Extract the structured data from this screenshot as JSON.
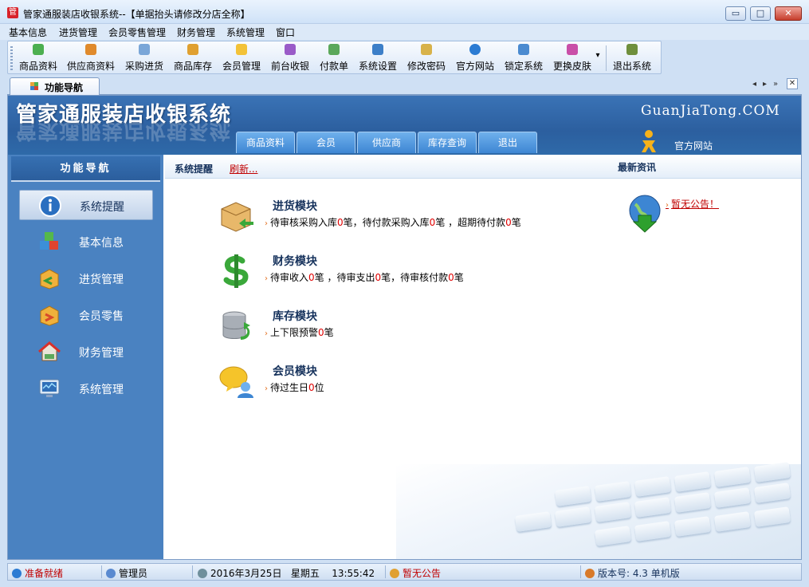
{
  "window": {
    "title": "管家通服装店收银系统--【单据抬头请修改分店全称】",
    "app_icon": "管",
    "minimize_glyph": "▭",
    "maximize_glyph": "□",
    "close_glyph": "✕"
  },
  "menu": [
    "基本信息",
    "进货管理",
    "会员零售管理",
    "财务管理",
    "系统管理",
    "窗口"
  ],
  "toolbar": [
    {
      "label": "商品资料",
      "icon": "goods-icon",
      "color": "#4caf50"
    },
    {
      "label": "供应商资料",
      "icon": "supplier-icon",
      "color": "#e08a2c"
    },
    {
      "label": "采购进货",
      "icon": "purchase-icon",
      "color": "#7aa6d8"
    },
    {
      "label": "商品库存",
      "icon": "inventory-icon",
      "color": "#e0a030"
    },
    {
      "label": "会员管理",
      "icon": "member-icon",
      "color": "#f3c238"
    },
    {
      "label": "前台收银",
      "icon": "cashier-icon",
      "color": "#9a5bc8"
    },
    {
      "label": "付款单",
      "icon": "payment-icon",
      "color": "#5ba85b"
    },
    {
      "label": "系统设置",
      "icon": "settings-icon",
      "color": "#3d7fc8"
    },
    {
      "label": "修改密码",
      "icon": "key-icon",
      "color": "#d8b24a"
    },
    {
      "label": "官方网站",
      "icon": "ie-icon",
      "color": "#2b7bd3"
    },
    {
      "label": "锁定系统",
      "icon": "lock-icon",
      "color": "#4a8ad0"
    },
    {
      "label": "更换皮肤",
      "icon": "skin-icon",
      "color": "#c94fa8"
    },
    {
      "label": "退出系统",
      "icon": "exit-icon",
      "color": "#6f8f3c"
    }
  ],
  "toolbar_dropdown_glyph": "▾",
  "tabs": {
    "active": "功能导航",
    "prev_glyph": "◂",
    "next_glyph": "▸",
    "overflow_glyph": "»",
    "close_glyph": "✕"
  },
  "banner": {
    "title": "管家通服装店收银系统",
    "site": "GuanJiaTong.COM",
    "nav": [
      "商品资料",
      "会员",
      "供应商",
      "库存查询",
      "退出"
    ],
    "official_link": "官方网站"
  },
  "sidebar": {
    "title": "功能导航",
    "items": [
      {
        "label": "系统提醒",
        "icon": "info-icon",
        "active": true
      },
      {
        "label": "基本信息",
        "icon": "cubes-icon",
        "active": false
      },
      {
        "label": "进货管理",
        "icon": "box-in-icon",
        "active": false
      },
      {
        "label": "会员零售",
        "icon": "box-out-icon",
        "active": false
      },
      {
        "label": "财务管理",
        "icon": "house-money-icon",
        "active": false
      },
      {
        "label": "系统管理",
        "icon": "monitor-icon",
        "active": false
      }
    ]
  },
  "content": {
    "header": {
      "title": "系统提醒",
      "refresh": "刷新...",
      "news": "最新资讯"
    },
    "bullet": "›",
    "modules": [
      {
        "title": "进货模块",
        "icon": "box-arrow-icon",
        "line": [
          {
            "t": "待审核采购入库"
          },
          {
            "t": "0",
            "red": true
          },
          {
            "t": "笔，待付款采购入库"
          },
          {
            "t": "0",
            "red": true
          },
          {
            "t": "笔 ，超期待付款"
          },
          {
            "t": "0",
            "red": true
          },
          {
            "t": "笔"
          }
        ]
      },
      {
        "title": "财务模块",
        "icon": "dollar-icon",
        "line": [
          {
            "t": "待审收入"
          },
          {
            "t": "0",
            "red": true
          },
          {
            "t": "笔 ，待审支出"
          },
          {
            "t": "0",
            "red": true
          },
          {
            "t": "笔，待审核付款"
          },
          {
            "t": "0",
            "red": true
          },
          {
            "t": "笔"
          }
        ]
      },
      {
        "title": "库存模块",
        "icon": "database-icon",
        "line": [
          {
            "t": "上下限预警"
          },
          {
            "t": "0",
            "red": true
          },
          {
            "t": "笔"
          }
        ]
      },
      {
        "title": "会员模块",
        "icon": "chat-member-icon",
        "line": [
          {
            "t": "待过生日"
          },
          {
            "t": "0",
            "red": true
          },
          {
            "t": "位"
          }
        ]
      }
    ],
    "notice": "暂无公告！"
  },
  "statusbar": {
    "ready": "准备就绪",
    "user": "管理员",
    "date": "2016年3月25日",
    "weekday": "星期五",
    "time": "13:55:42",
    "notice": "暂无公告",
    "version": "版本号: 4.3 单机版"
  },
  "colors": {
    "accent": "#2c5f9f",
    "sidebar": "#4a82c1",
    "alert": "#e00000"
  }
}
